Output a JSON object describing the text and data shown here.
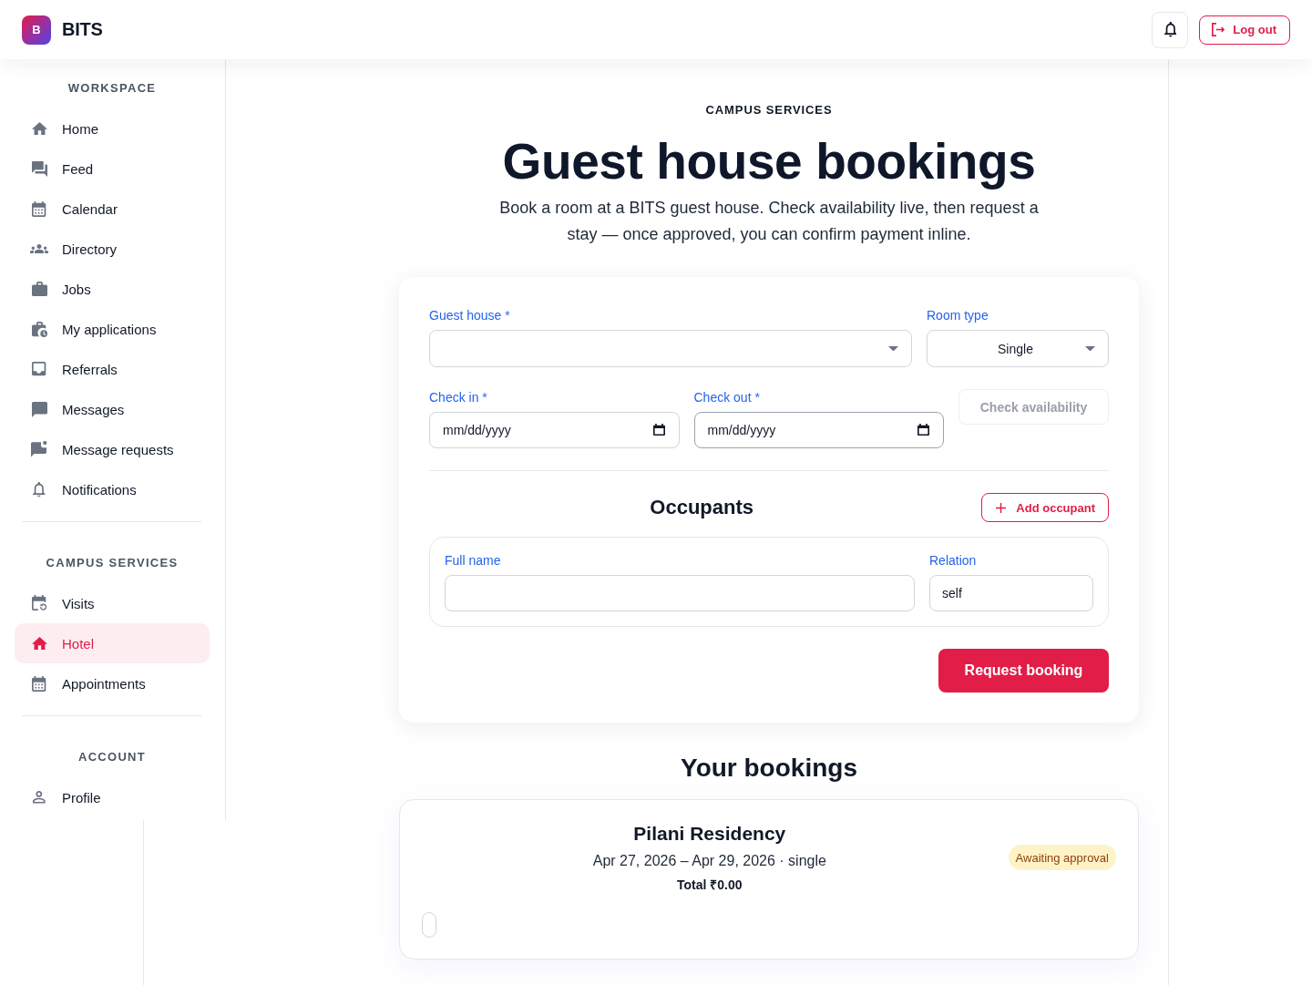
{
  "header": {
    "logo": "B",
    "brand": "BITS",
    "logout": "Log out"
  },
  "sidebar": {
    "sections": [
      {
        "title": "WORKSPACE",
        "items": [
          {
            "label": "Home",
            "selected": false
          },
          {
            "label": "Feed",
            "selected": false
          },
          {
            "label": "Calendar",
            "selected": false
          },
          {
            "label": "Directory",
            "selected": false
          },
          {
            "label": "Jobs",
            "selected": false
          },
          {
            "label": "My applications",
            "selected": false
          },
          {
            "label": "Referrals",
            "selected": false
          },
          {
            "label": "Messages",
            "selected": false
          },
          {
            "label": "Message requests",
            "selected": false
          },
          {
            "label": "Notifications",
            "selected": false
          }
        ]
      },
      {
        "title": "CAMPUS SERVICES",
        "items": [
          {
            "label": "Visits",
            "selected": false
          },
          {
            "label": "Hotel",
            "selected": true
          },
          {
            "label": "Appointments",
            "selected": false
          }
        ]
      },
      {
        "title": "ACCOUNT",
        "items": [
          {
            "label": "Profile",
            "selected": false
          }
        ]
      }
    ]
  },
  "page": {
    "eyebrow": "CAMPUS SERVICES",
    "title": "Guest house bookings",
    "subtitle": "Book a room at a BITS guest house. Check availability live, then request a stay — once approved, you can confirm payment inline."
  },
  "booking_form": {
    "guest_house": {
      "label": "Guest house *"
    },
    "room_type": {
      "label": "Room type",
      "value": "Single"
    },
    "check_in": {
      "label": "Check in *",
      "placeholder": "mm/dd/yyyy",
      "focused": false
    },
    "check_out": {
      "label": "Check out *",
      "placeholder": "mm/dd/yyyy",
      "focused": true
    },
    "check_availability": {
      "label": "Check availability",
      "disabled": true
    },
    "occupants": {
      "title": "Occupants",
      "add_button": "Add occupant",
      "rows": [
        {
          "full_name": {
            "label": "Full name"
          },
          "relation": {
            "label": "Relation",
            "value": "self"
          }
        }
      ]
    },
    "submit": "Request booking"
  },
  "bookings": {
    "title": "Your bookings",
    "items": [
      {
        "name": "Pilani Residency",
        "details": "Apr 27, 2026 – Apr 29, 2026 · single",
        "total": "Total ₹0.00",
        "status": {
          "label": "Awaiting approval",
          "kind": "pending"
        }
      }
    ]
  }
}
